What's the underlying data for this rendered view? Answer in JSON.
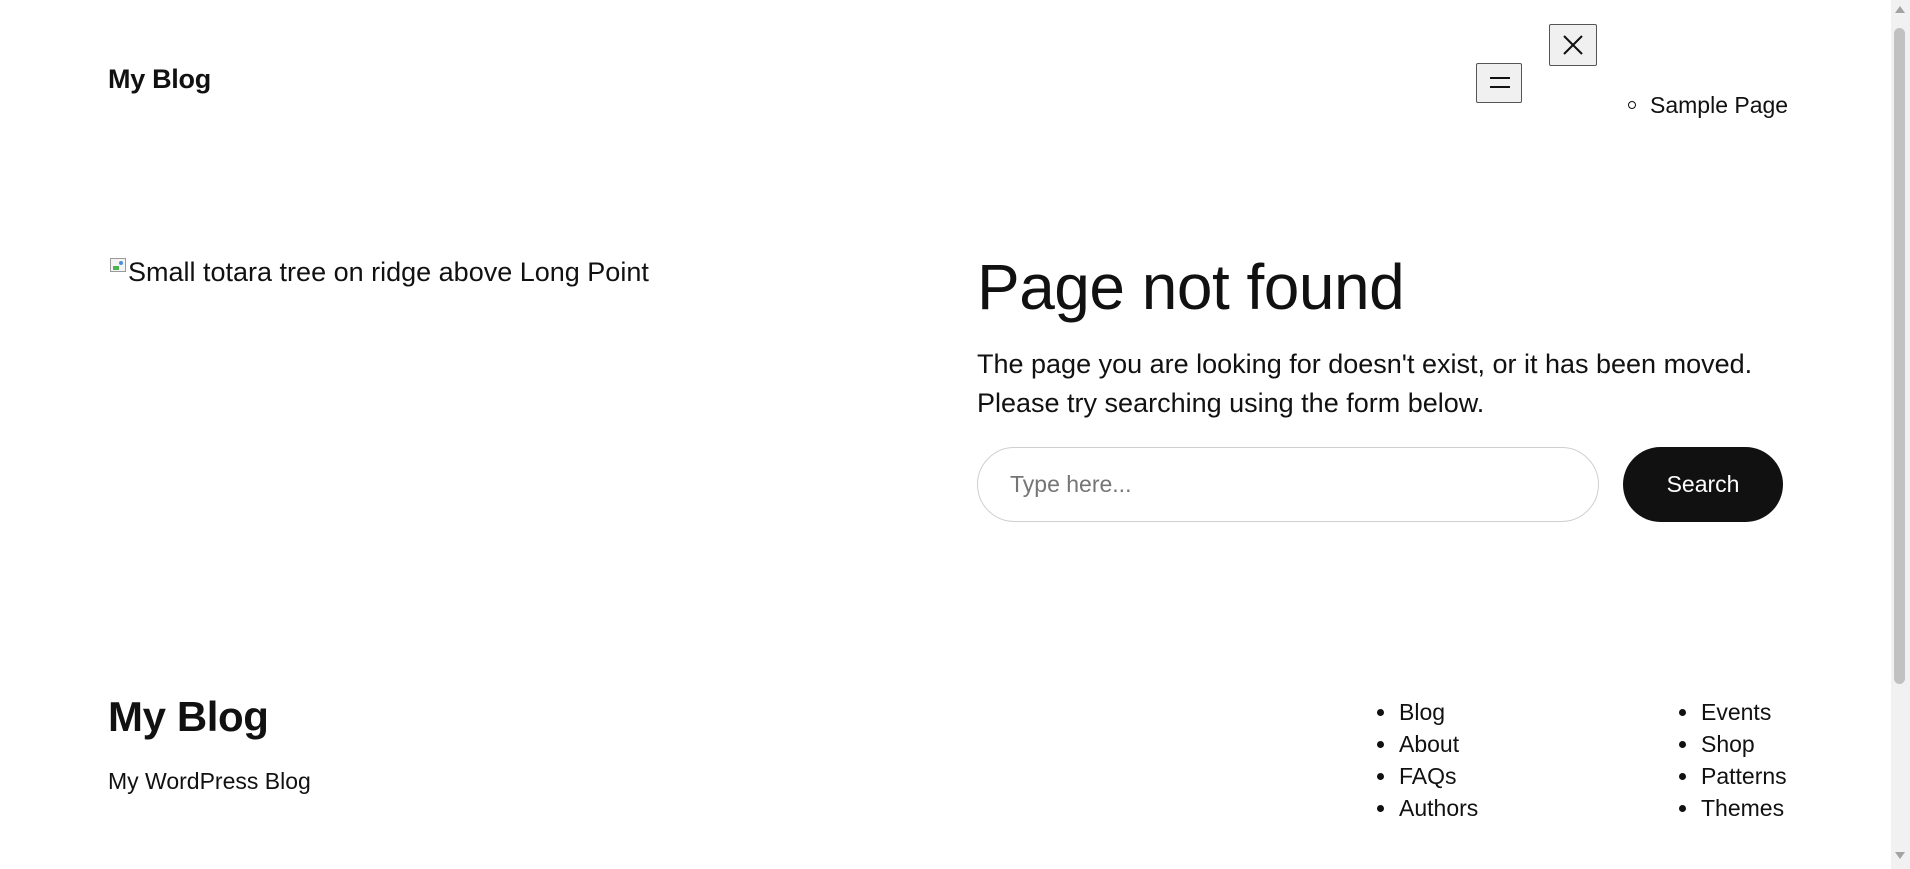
{
  "header": {
    "site_title": "My Blog",
    "nav_items": [
      {
        "label": "Sample Page"
      }
    ]
  },
  "main": {
    "image_alt": "Small totara tree on ridge above Long Point",
    "title": "Page not found",
    "description": "The page you are looking for doesn't exist, or it has been moved. Please try searching using the form below.",
    "search": {
      "placeholder": "Type here...",
      "button_label": "Search"
    }
  },
  "footer": {
    "site_title": "My Blog",
    "tagline": "My WordPress Blog",
    "col1": [
      {
        "label": "Blog"
      },
      {
        "label": "About"
      },
      {
        "label": "FAQs"
      },
      {
        "label": "Authors"
      }
    ],
    "col2": [
      {
        "label": "Events"
      },
      {
        "label": "Shop"
      },
      {
        "label": "Patterns"
      },
      {
        "label": "Themes"
      }
    ]
  },
  "icons": {
    "menu": "hamburger-icon",
    "close": "close-icon",
    "broken_image": "broken-image-icon"
  }
}
